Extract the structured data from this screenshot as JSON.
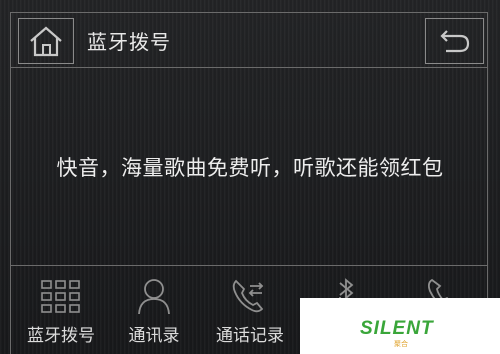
{
  "header": {
    "title": "蓝牙拨号",
    "home_icon": "home-icon",
    "back_icon": "back-icon"
  },
  "main": {
    "message": "快音，海量歌曲免费听，听歌还能领红包"
  },
  "tabs": [
    {
      "label": "蓝牙拨号",
      "icon": "dialpad-icon"
    },
    {
      "label": "通讯录",
      "icon": "contacts-icon"
    },
    {
      "label": "通话记录",
      "icon": "call-log-icon"
    },
    {
      "label": "",
      "icon": "bluetooth-music-icon"
    },
    {
      "label": "",
      "icon": "phone-icon"
    }
  ],
  "watermark": {
    "logo": "SILENT",
    "sub": "聚合"
  },
  "colors": {
    "background": "#1b1c1e",
    "border": "#6b6b6b",
    "text": "#e6e6e6",
    "watermark_green": "#3aa63a",
    "watermark_orange": "#e0a22a"
  }
}
